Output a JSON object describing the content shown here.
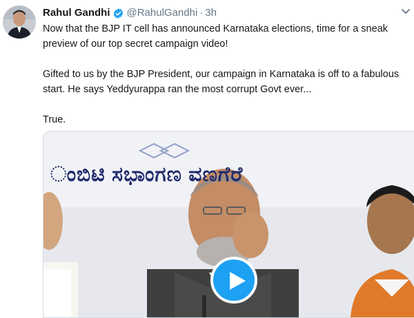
{
  "user": {
    "name": "Rahul Gandhi",
    "handle": "@RahulGandhi",
    "time": "3h",
    "separator": "·"
  },
  "icons": {
    "avatar": "user-avatar",
    "verified": "verified-badge-icon",
    "caret": "chevron-down-icon",
    "play": "play-icon"
  },
  "colors": {
    "accent": "#1da1f2",
    "text": "#14171a",
    "muted": "#657786"
  },
  "tweet": {
    "paragraph1": "Now that the BJP IT cell has announced Karnataka elections, time for a sneak preview of our top secret campaign video!",
    "paragraph2": "Gifted to us by the BJP President, our campaign in Karnataka is off to a fabulous start. He says Yeddyurappa ran the most corrupt Govt ever...",
    "paragraph3": "True."
  },
  "media": {
    "banner_text": "ಂಬಿಟಿ ಸಭಾಂಗಣ ವಣಗೆರೆ"
  }
}
